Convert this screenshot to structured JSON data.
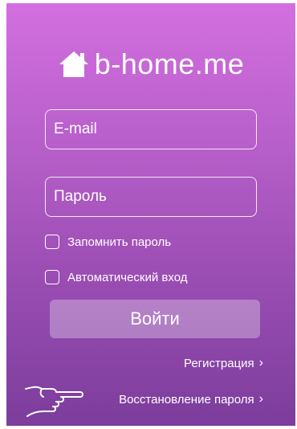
{
  "logo": {
    "text": "b-home.me",
    "icon": "house-icon"
  },
  "login_form": {
    "email_placeholder": "E-mail",
    "password_placeholder": "Пароль",
    "remember_label": "Запомнить пароль",
    "auto_login_label": "Автоматический вход",
    "submit_label": "Войти"
  },
  "links": {
    "register_label": "Регистрация",
    "recover_label": "Восстановление пароля",
    "chevron": "›"
  },
  "icons": {
    "pointer": "pointing-hand-icon"
  },
  "colors": {
    "gradient_top": "#d36fe0",
    "gradient_bottom": "#7c3d9c",
    "text": "#ffffff"
  }
}
